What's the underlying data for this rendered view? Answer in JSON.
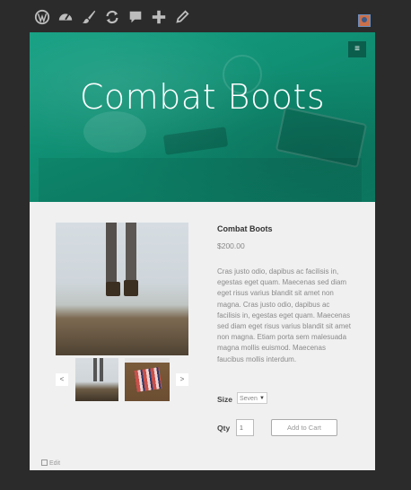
{
  "admin_bar": {
    "icons": [
      "wordpress-icon",
      "dashboard-icon",
      "customize-brush-icon",
      "updates-icon",
      "comments-icon",
      "new-content-icon",
      "edit-pencil-icon"
    ],
    "avatar": "user-avatar"
  },
  "hero": {
    "title": "Combat Boots",
    "menu_icon": "≡",
    "color": "#14a083"
  },
  "product": {
    "title": "Combat Boots",
    "price": "$200.00",
    "description": "Cras justo odio, dapibus ac facilisis in, egestas eget quam. Maecenas sed diam eget risus varius blandit sit amet non magna. Cras justo odio, dapibus ac facilisis in, egestas eget quam. Maecenas sed diam eget risus varius blandit sit amet non magna. Etiam porta sem malesuada magna mollis euismod. Maecenas faucibus mollis interdum.",
    "size_label": "Size",
    "size_value": "Seven",
    "qty_label": "Qty",
    "qty_value": "1",
    "add_to_cart": "Add to Cart",
    "prev": "<",
    "next": ">"
  },
  "footer": {
    "edit_label": "Edit"
  }
}
